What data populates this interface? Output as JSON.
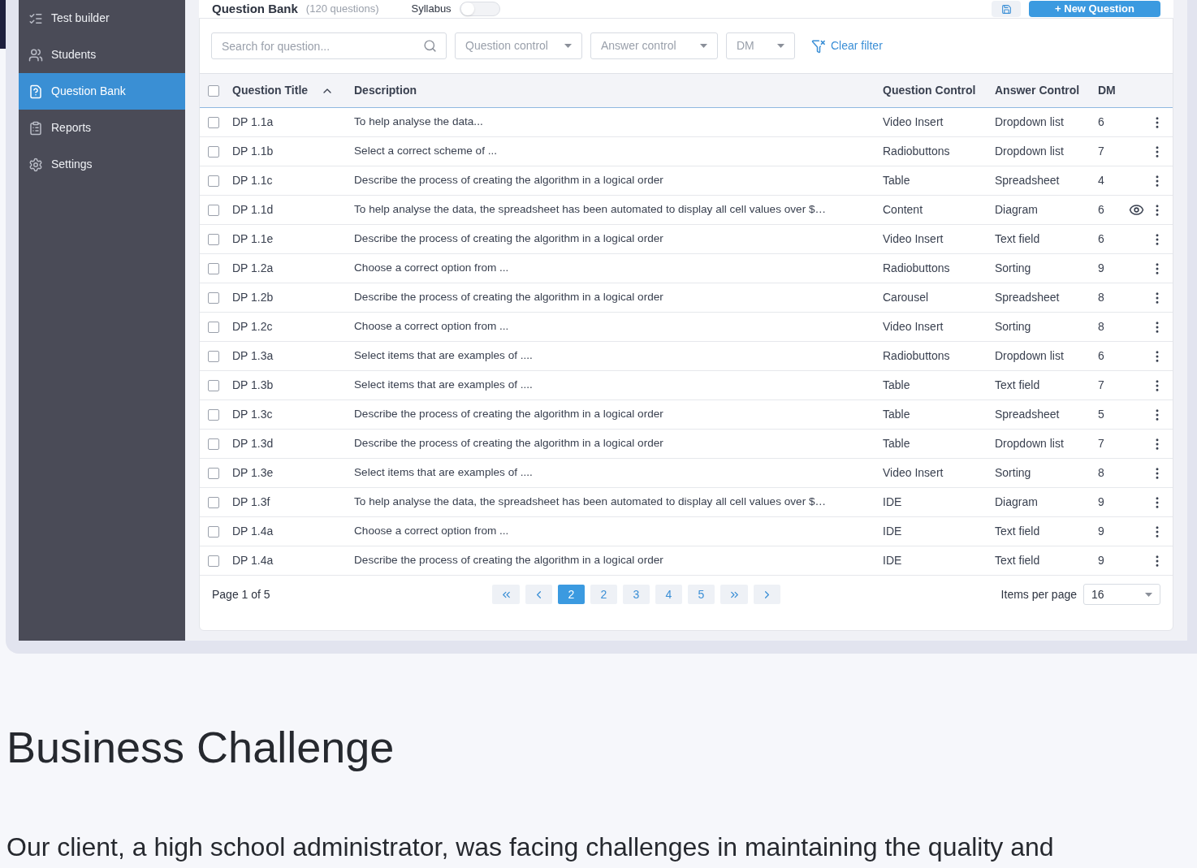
{
  "sidebar": {
    "items": [
      {
        "label": "Test builder",
        "selected": false
      },
      {
        "label": "Students",
        "selected": false
      },
      {
        "label": "Question Bank",
        "selected": true
      },
      {
        "label": "Reports",
        "selected": false
      },
      {
        "label": "Settings",
        "selected": false
      }
    ]
  },
  "header": {
    "title": "Question Bank",
    "count": "(120 questions)",
    "toggle": {
      "label": "Syllabus",
      "on": false
    },
    "new_button": "+ New Question"
  },
  "filters": {
    "search": {
      "placeholder": "Search for question..."
    },
    "dropdowns": [
      {
        "placeholder": "Question control"
      },
      {
        "placeholder": "Answer control"
      },
      {
        "placeholder": "DM"
      }
    ],
    "clear": "Clear filter"
  },
  "table": {
    "all_checked": false,
    "columns": [
      "Question Title",
      "Description",
      "Question Control",
      "Answer Control",
      "DM"
    ],
    "rows": [
      {
        "title": "DP 1.1a",
        "description": "To help analyse the data...",
        "question_control": "Video Insert",
        "answer_control": "Dropdown list",
        "dm": "6",
        "checked": false,
        "preview": false
      },
      {
        "title": "DP 1.1b",
        "description": "Select a correct scheme of ...",
        "question_control": "Radiobuttons",
        "answer_control": "Dropdown list",
        "dm": "7",
        "checked": false,
        "preview": false
      },
      {
        "title": "DP 1.1c",
        "description": "Describe the process of creating the algorithm in a logical order",
        "question_control": "Table",
        "answer_control": "Spreadsheet",
        "dm": "4",
        "checked": false,
        "preview": false
      },
      {
        "title": "DP 1.1d",
        "description": "To help analyse the data, the spreadsheet has been automated to display all cell values over $…",
        "question_control": "Content",
        "answer_control": "Diagram",
        "dm": "6",
        "checked": false,
        "preview": true
      },
      {
        "title": "DP 1.1e",
        "description": "Describe the process of creating the algorithm in a logical order",
        "question_control": "Video Insert",
        "answer_control": "Text field",
        "dm": "6",
        "checked": false,
        "preview": false
      },
      {
        "title": "DP 1.2a",
        "description": "Choose a correct option from ...",
        "question_control": "Radiobuttons",
        "answer_control": "Sorting",
        "dm": "9",
        "checked": false,
        "preview": false
      },
      {
        "title": "DP 1.2b",
        "description": "Describe the process of creating the algorithm in a logical order",
        "question_control": "Carousel",
        "answer_control": "Spreadsheet",
        "dm": "8",
        "checked": false,
        "preview": false
      },
      {
        "title": "DP 1.2c",
        "description": "Choose a correct option from ...",
        "question_control": "Video Insert",
        "answer_control": "Sorting",
        "dm": "8",
        "checked": false,
        "preview": false
      },
      {
        "title": "DP 1.3a",
        "description": "Select items that are examples of ....",
        "question_control": "Radiobuttons",
        "answer_control": "Dropdown list",
        "dm": "6",
        "checked": false,
        "preview": false
      },
      {
        "title": "DP 1.3b",
        "description": "Select items that are examples of ....",
        "question_control": "Table",
        "answer_control": "Text field",
        "dm": "7",
        "checked": false,
        "preview": false
      },
      {
        "title": "DP 1.3c",
        "description": "Describe the process of creating the algorithm in a logical order",
        "question_control": "Table",
        "answer_control": "Spreadsheet",
        "dm": "5",
        "checked": false,
        "preview": false
      },
      {
        "title": "DP 1.3d",
        "description": "Describe the process of creating the algorithm in a logical order",
        "question_control": "Table",
        "answer_control": "Dropdown list",
        "dm": "7",
        "checked": false,
        "preview": false
      },
      {
        "title": "DP 1.3e",
        "description": "Select items that are examples of ....",
        "question_control": "Video Insert",
        "answer_control": "Sorting",
        "dm": "8",
        "checked": false,
        "preview": false
      },
      {
        "title": "DP 1.3f",
        "description": "To help analyse the data, the spreadsheet has been automated to display all cell values over $…",
        "question_control": "IDE",
        "answer_control": "Diagram",
        "dm": "9",
        "checked": false,
        "preview": false
      },
      {
        "title": "DP 1.4a",
        "description": "Choose a correct option from ...",
        "question_control": "IDE",
        "answer_control": "Text field",
        "dm": "9",
        "checked": false,
        "preview": false
      },
      {
        "title": "DP 1.4a",
        "description": "Describe the process of creating the algorithm in a logical order",
        "question_control": "IDE",
        "answer_control": "Text field",
        "dm": "9",
        "checked": false,
        "preview": false
      }
    ]
  },
  "pagination": {
    "page_info": "Page 1 of 5",
    "buttons": [
      {
        "kind": "first"
      },
      {
        "kind": "prev"
      },
      {
        "kind": "page",
        "label": "2",
        "selected": true
      },
      {
        "kind": "page",
        "label": "2",
        "selected": false
      },
      {
        "kind": "page",
        "label": "3",
        "selected": false
      },
      {
        "kind": "page",
        "label": "4",
        "selected": false
      },
      {
        "kind": "page",
        "label": "5",
        "selected": false
      },
      {
        "kind": "last"
      },
      {
        "kind": "next"
      }
    ],
    "items_per_page": {
      "label": "Items per page",
      "value": "16"
    }
  },
  "article": {
    "heading": "Business Challenge",
    "paragraph": "Our client, a high school administrator, was facing challenges in maintaining the quality and"
  }
}
